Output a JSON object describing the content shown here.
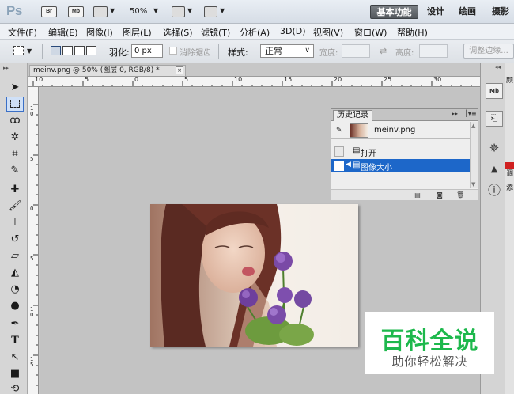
{
  "app": {
    "logo": "Ps"
  },
  "titlebar": {
    "badges": [
      "Br",
      "Mb"
    ],
    "zoom": "50%",
    "workspaces": [
      "基本功能",
      "设计",
      "绘画",
      "摄影"
    ]
  },
  "menu": [
    "文件(F)",
    "编辑(E)",
    "图像(I)",
    "图层(L)",
    "选择(S)",
    "滤镜(T)",
    "分析(A)",
    "3D(D)",
    "视图(V)",
    "窗口(W)",
    "帮助(H)"
  ],
  "options": {
    "feather_label": "羽化:",
    "feather_value": "0 px",
    "antialias_label": "消除锯齿",
    "style_label": "样式:",
    "style_value": "正常",
    "width_label": "宽度:",
    "height_label": "高度:",
    "refine_button": "调整边缘..."
  },
  "document": {
    "tab_title": "meinv.png @ 50% (图层 0, RGB/8) *",
    "close_symbol": "×",
    "ruler_h": [
      "10",
      "5",
      "0",
      "5",
      "10",
      "15",
      "20",
      "25",
      "30"
    ],
    "ruler_v": [
      "10",
      "5",
      "0",
      "5",
      "10",
      "15"
    ]
  },
  "history": {
    "tab_label": "历史记录",
    "snapshot_name": "meinv.png",
    "steps": [
      "打开",
      "图像大小"
    ],
    "selected_step": "图像大小"
  },
  "right_strip": [
    "颜",
    "调",
    "添"
  ],
  "watermark": {
    "title": "百科全说",
    "subtitle": "助你轻松解决"
  },
  "colors": {
    "history_selected": "#1d67c9",
    "watermark_green": "#1db84c",
    "workspace_active": "#5c6165"
  }
}
